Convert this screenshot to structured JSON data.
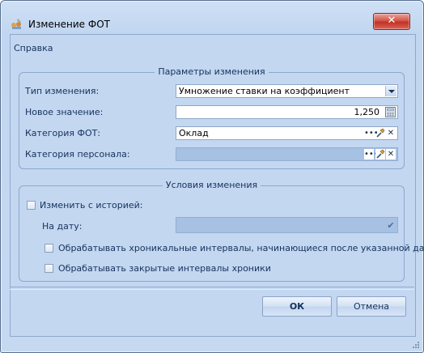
{
  "window": {
    "title": "Изменение ФОТ",
    "close_label": "✕"
  },
  "help_link": "Справка",
  "params_group": {
    "caption": "Параметры изменения",
    "change_type_label": "Тип изменения:",
    "change_type_value": "Умножение ставки на коэффициент",
    "new_value_label": "Новое значение:",
    "new_value": "1,250",
    "fot_category_label": "Категория ФОТ:",
    "fot_category_value": "Оклад",
    "staff_category_label": "Категория персонала:",
    "staff_category_value": ""
  },
  "conditions_group": {
    "caption": "Условия изменения",
    "history_checkbox_label": "Изменить с историей:",
    "history_checked": false,
    "date_label": "На дату:",
    "date_value": "",
    "process_after_label": "Обрабатывать хроникальные интервалы, начинающиеся после указанной даты",
    "process_after_checked": false,
    "process_closed_label": "Обрабатывать закрытые интервалы хроники",
    "process_closed_checked": false
  },
  "buttons": {
    "ok": "ОК",
    "cancel": "Отмена"
  },
  "icons": {
    "app": "wrench-people-icon",
    "ellipsis": "ellipsis-icon",
    "pick": "pick-tool-icon",
    "clear": "clear-x-icon",
    "calculator": "calculator-icon",
    "dropdown": "chevron-down-icon",
    "date_check": "check-icon"
  }
}
